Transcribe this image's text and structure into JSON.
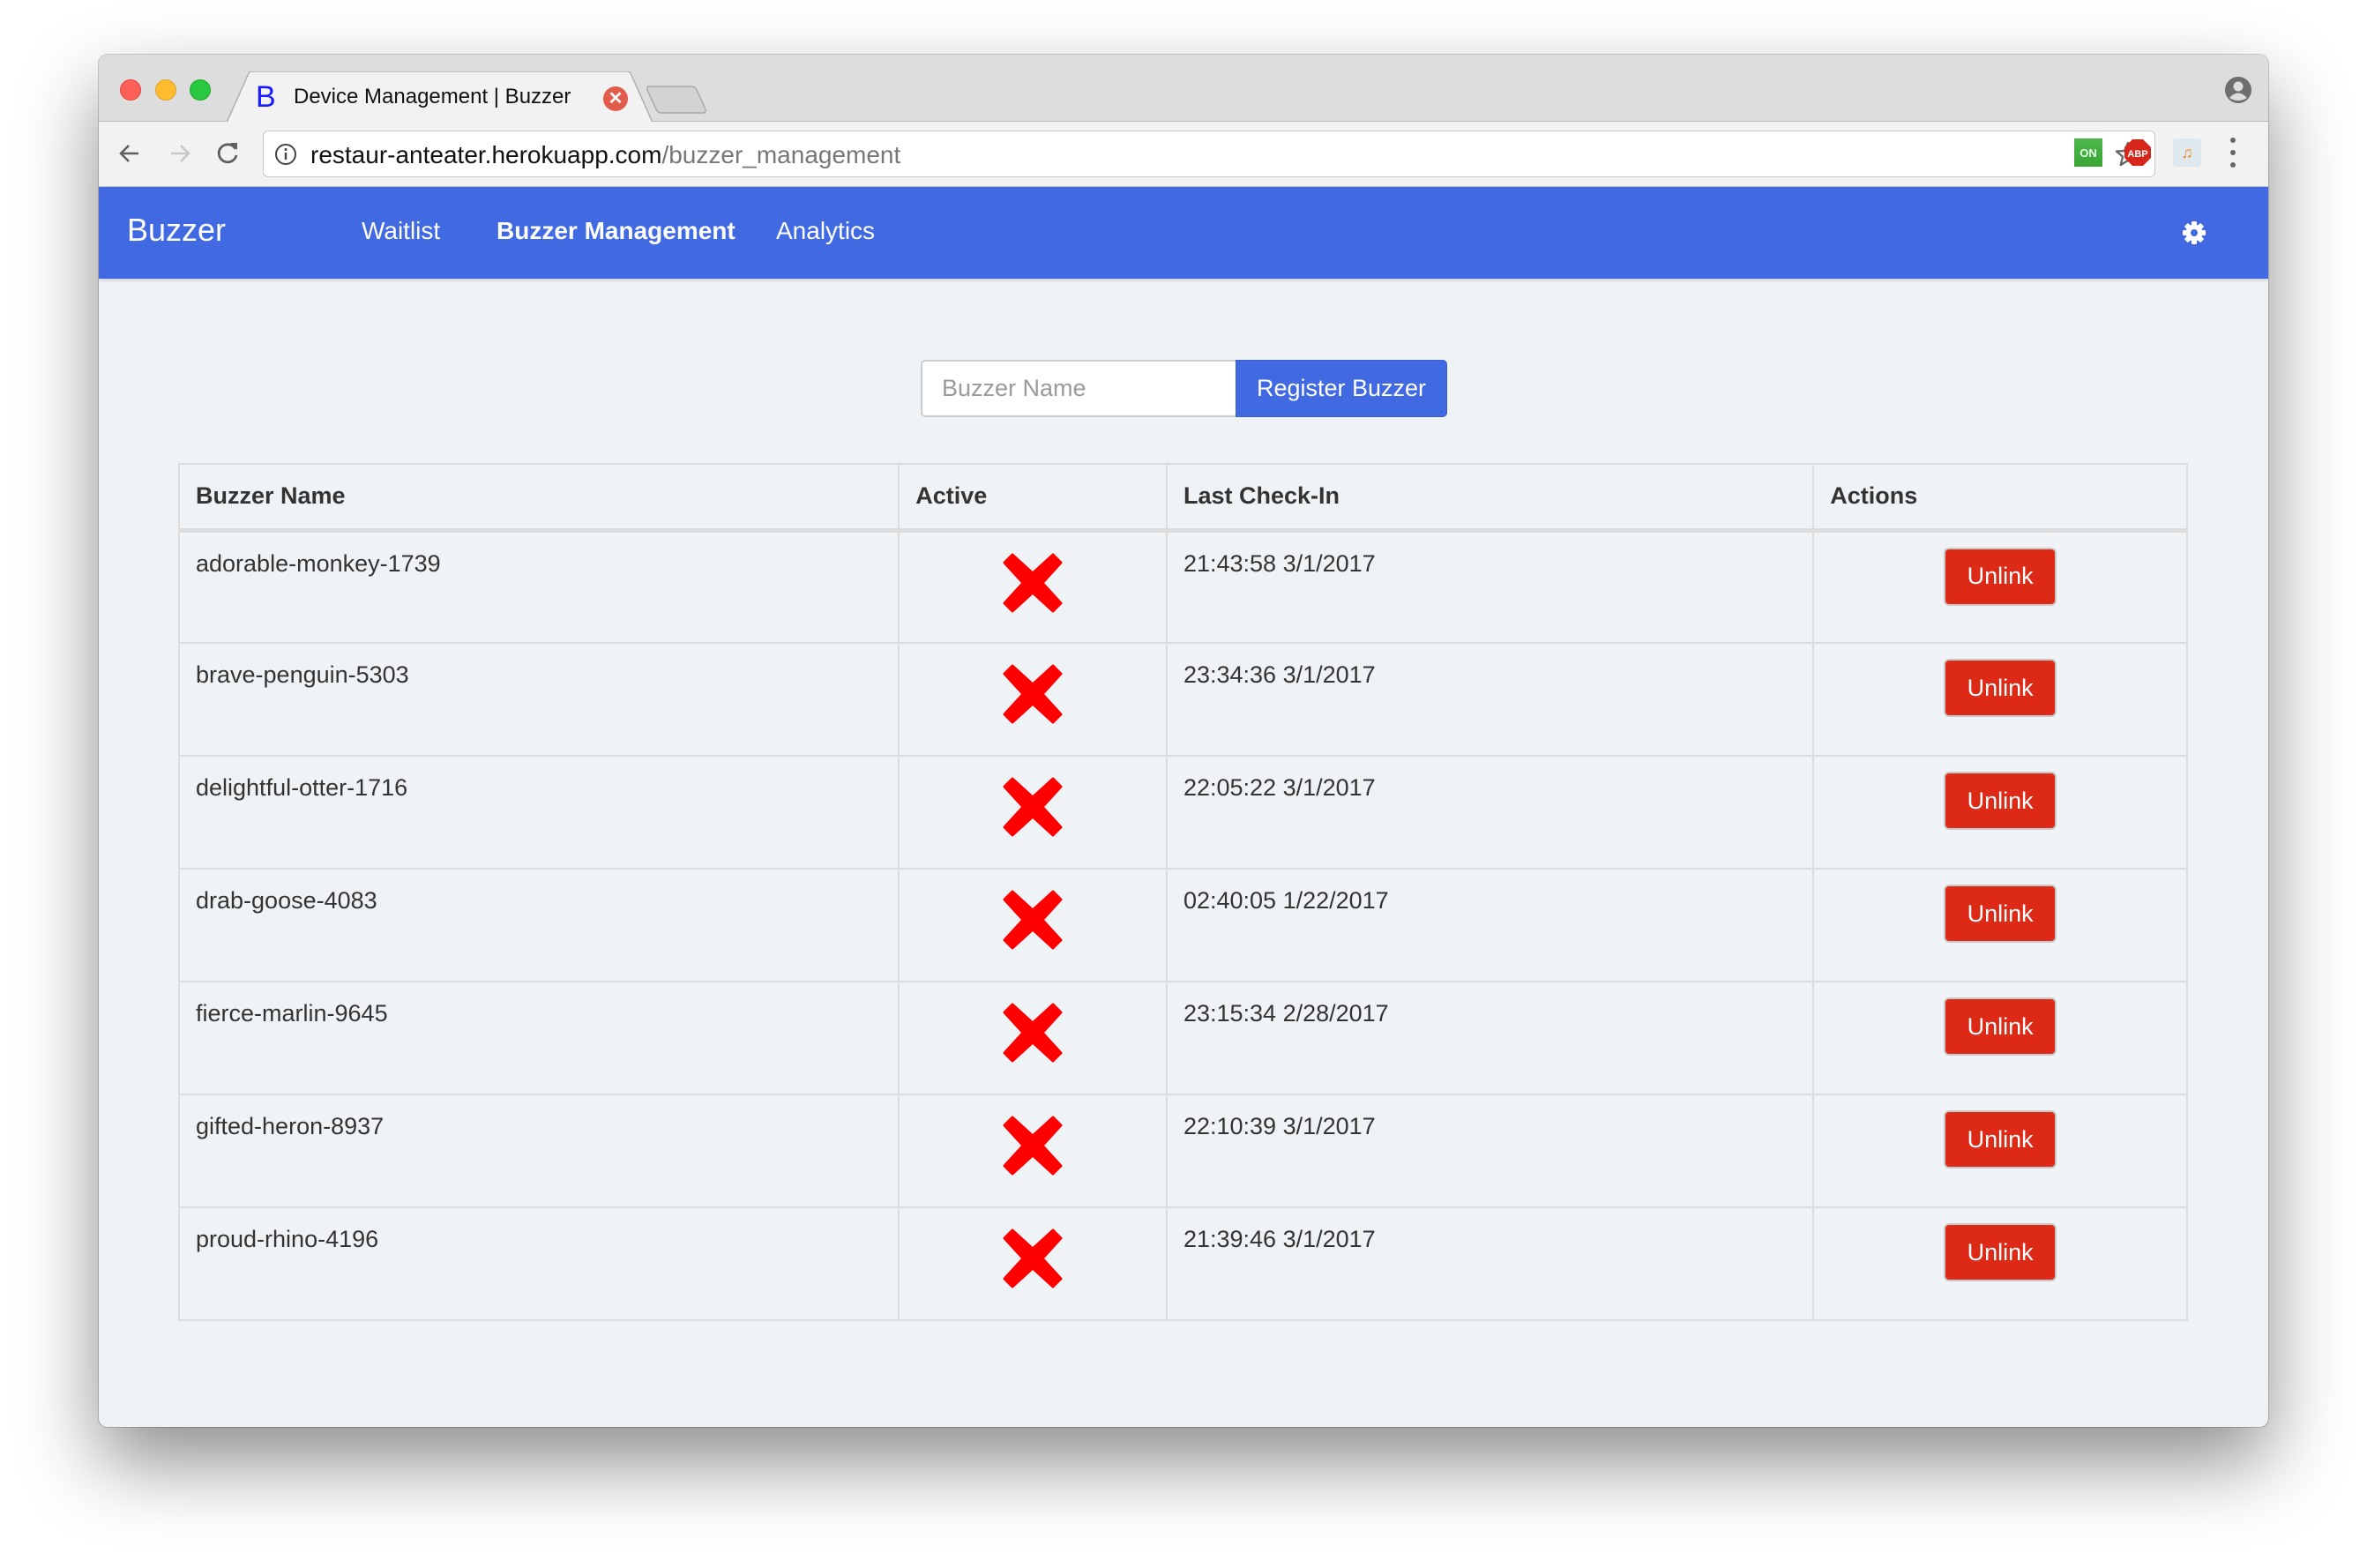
{
  "browser": {
    "tab": {
      "favicon_letter": "B",
      "title": "Device Management | Buzzer"
    },
    "url": {
      "host": "restaur-anteater.herokuapp.com",
      "path": "/buzzer_management"
    },
    "extensions": [
      {
        "name": "on-extension",
        "label": "ON",
        "color": "#3fae3c"
      },
      {
        "name": "adblock-plus",
        "label": "ABP",
        "color": "#d7261c"
      },
      {
        "name": "cloud-music",
        "label": "♫",
        "color": "#f08a24"
      }
    ]
  },
  "navbar": {
    "brand": "Buzzer",
    "links": [
      {
        "label": "Waitlist",
        "active": false
      },
      {
        "label": "Buzzer Management",
        "active": true
      },
      {
        "label": "Analytics",
        "active": false
      }
    ],
    "settings_icon": "gear-icon",
    "color": "#4169e2"
  },
  "register": {
    "input_value": "",
    "input_placeholder": "Buzzer Name",
    "button_label": "Register Buzzer"
  },
  "table": {
    "columns": [
      "Buzzer Name",
      "Active",
      "Last Check-In",
      "Actions"
    ],
    "rows": [
      {
        "name": "adorable-monkey-1739",
        "active": false,
        "last_check_in": "21:43:58 3/1/2017",
        "action": "Unlink"
      },
      {
        "name": "brave-penguin-5303",
        "active": false,
        "last_check_in": "23:34:36 3/1/2017",
        "action": "Unlink"
      },
      {
        "name": "delightful-otter-1716",
        "active": false,
        "last_check_in": "22:05:22 3/1/2017",
        "action": "Unlink"
      },
      {
        "name": "drab-goose-4083",
        "active": false,
        "last_check_in": "02:40:05 1/22/2017",
        "action": "Unlink"
      },
      {
        "name": "fierce-marlin-9645",
        "active": false,
        "last_check_in": "23:15:34 2/28/2017",
        "action": "Unlink"
      },
      {
        "name": "gifted-heron-8937",
        "active": false,
        "last_check_in": "22:10:39 3/1/2017",
        "action": "Unlink"
      },
      {
        "name": "proud-rhino-4196",
        "active": false,
        "last_check_in": "21:39:46 3/1/2017",
        "action": "Unlink"
      }
    ],
    "inactive_icon": "red-x-icon",
    "inactive_color": "#ff0000",
    "unlink_color": "#dc2a17"
  }
}
